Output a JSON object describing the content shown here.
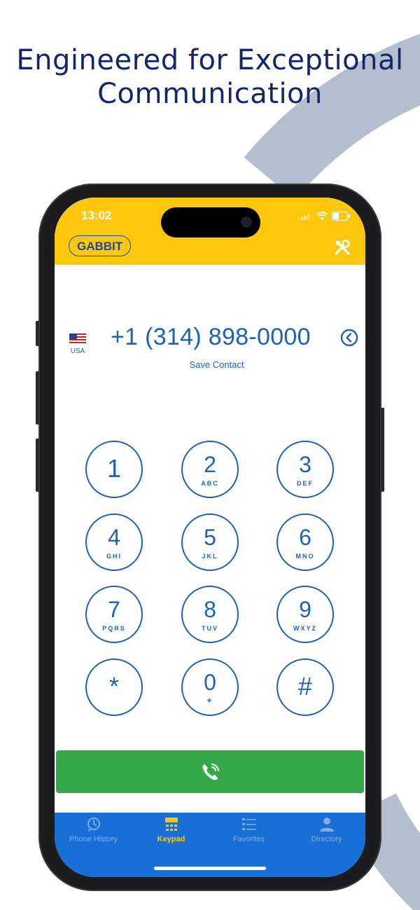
{
  "headline": {
    "line1": "Engineered for Exceptional",
    "line2": "Communication"
  },
  "status_bar": {
    "time": "13:02",
    "icons": [
      "signal-icon",
      "wifi-icon",
      "battery-icon"
    ]
  },
  "app_header": {
    "brand": "GABBIT",
    "tools_icon": "tools-icon"
  },
  "dialer": {
    "country_label": "USA",
    "flag_icon": "us-flag-icon",
    "number": "+1 (314) 898-0000",
    "backspace_icon": "backspace-icon",
    "save_contact": "Save Contact"
  },
  "keypad": [
    {
      "digit": "1",
      "letters": ""
    },
    {
      "digit": "2",
      "letters": "ABC"
    },
    {
      "digit": "3",
      "letters": "DEF"
    },
    {
      "digit": "4",
      "letters": "GHI"
    },
    {
      "digit": "5",
      "letters": "JKL"
    },
    {
      "digit": "6",
      "letters": "MNO"
    },
    {
      "digit": "7",
      "letters": "PQRS"
    },
    {
      "digit": "8",
      "letters": "TUV"
    },
    {
      "digit": "9",
      "letters": "WXYZ"
    },
    {
      "digit": "*",
      "letters": ""
    },
    {
      "digit": "0",
      "letters": "+"
    },
    {
      "digit": "#",
      "letters": ""
    }
  ],
  "call_button": {
    "icon": "phone-call-icon"
  },
  "tabs": [
    {
      "label": "Phone History",
      "icon": "history-icon",
      "active": false
    },
    {
      "label": "Keypad",
      "icon": "keypad-icon",
      "active": true
    },
    {
      "label": "Favorites",
      "icon": "favorites-list-icon",
      "active": false
    },
    {
      "label": "Directory",
      "icon": "person-icon",
      "active": false
    }
  ],
  "colors": {
    "header_yellow": "#fdc80b",
    "primary_blue": "#1a63b8",
    "tabbar_blue": "#1a6fd6",
    "call_green": "#35a94a",
    "headline_navy": "#15256b",
    "arc_gray": "#b3bfce"
  }
}
